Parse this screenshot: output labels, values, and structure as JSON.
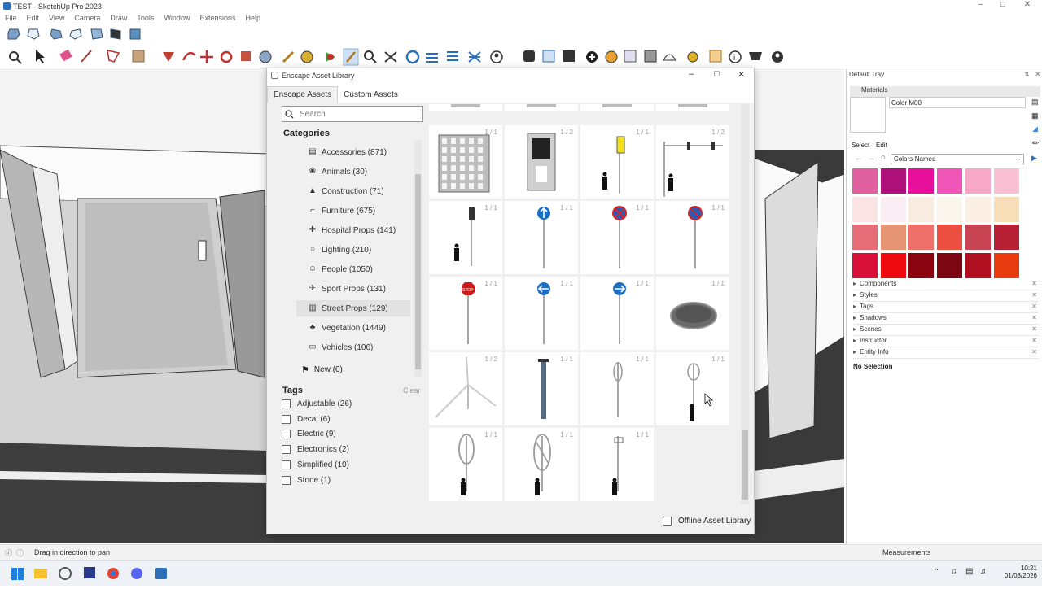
{
  "app": {
    "title": "TEST - SketchUp Pro 2023",
    "menu": [
      "File",
      "Edit",
      "View",
      "Camera",
      "Draw",
      "Tools",
      "Window",
      "Extensions",
      "Help"
    ]
  },
  "dialog": {
    "title": "Enscape Asset Library",
    "tabs": [
      "Enscape Assets",
      "Custom Assets"
    ],
    "search_placeholder": "Search",
    "categories_heading": "Categories",
    "categories": [
      {
        "label": "Accessories (871)",
        "icon": "accessories-icon"
      },
      {
        "label": "Animals (30)",
        "icon": "paw-icon"
      },
      {
        "label": "Construction (71)",
        "icon": "construction-icon"
      },
      {
        "label": "Furniture (675)",
        "icon": "chair-icon"
      },
      {
        "label": "Hospital Props (141)",
        "icon": "hospital-icon"
      },
      {
        "label": "Lighting (210)",
        "icon": "bulb-icon"
      },
      {
        "label": "People (1050)",
        "icon": "people-icon"
      },
      {
        "label": "Sport Props (131)",
        "icon": "sport-icon"
      },
      {
        "label": "Street Props (129)",
        "icon": "street-icon",
        "selected": true
      },
      {
        "label": "Vegetation (1449)",
        "icon": "tree-icon"
      },
      {
        "label": "Vehicles (106)",
        "icon": "car-icon"
      }
    ],
    "new_item": "New (0)",
    "tags_heading": "Tags",
    "clear_label": "Clear",
    "tags": [
      "Adjustable (26)",
      "Decal (6)",
      "Electric (9)",
      "Electronics (2)",
      "Simplified (10)",
      "Stone (1)"
    ],
    "assets": [
      {
        "count": "1 / 1",
        "kind": "building"
      },
      {
        "count": "1 / 2",
        "kind": "kiosk"
      },
      {
        "count": "1 / 1",
        "kind": "traffic-light-ped"
      },
      {
        "count": "1 / 2",
        "kind": "traffic-light-arm"
      },
      {
        "count": "1 / 1",
        "kind": "traffic-light-pole"
      },
      {
        "count": "1 / 1",
        "kind": "sign-blue-up"
      },
      {
        "count": "1 / 1",
        "kind": "sign-no-stop"
      },
      {
        "count": "1 / 1",
        "kind": "sign-no-parking"
      },
      {
        "count": "1 / 1",
        "kind": "sign-stop"
      },
      {
        "count": "1 / 1",
        "kind": "sign-blue-left"
      },
      {
        "count": "1 / 1",
        "kind": "sign-blue-right"
      },
      {
        "count": "1 / 1",
        "kind": "manhole"
      },
      {
        "count": "1 / 2",
        "kind": "wind-turbine"
      },
      {
        "count": "1 / 1",
        "kind": "pole"
      },
      {
        "count": "1 / 1",
        "kind": "vertical-turbine"
      },
      {
        "count": "1 / 1",
        "kind": "vertical-turbine-small"
      },
      {
        "count": "1 / 1",
        "kind": "vertical-turbine-large"
      },
      {
        "count": "1 / 1",
        "kind": "vertical-turbine-twist"
      },
      {
        "count": "1 / 1",
        "kind": "street-lamp-small"
      }
    ],
    "offline_label": "Offline Asset Library"
  },
  "tray": {
    "title": "Default Tray",
    "materials": "Materials",
    "material_name": "Color M00",
    "select": "Select",
    "edit": "Edit",
    "collection": "Colors-Named",
    "swatches": [
      "#e060a0",
      "#b0107a",
      "#e8109a",
      "#f055b8",
      "#f7a8c6",
      "#f9bfd2",
      "#fbe3e3",
      "#f8eef3",
      "#f7ecdf",
      "#faf6ee",
      "#fbeee3",
      "#f6dfb8",
      "#e66c78",
      "#e59574",
      "#ef6f6a",
      "#ec4e40",
      "#c84452",
      "#b52035",
      "#d8103a",
      "#ef0a10",
      "#8a0410",
      "#7c0612",
      "#b01020",
      "#e83c10"
    ],
    "sections": [
      "Components",
      "Styles",
      "Tags",
      "Shadows",
      "Scenes",
      "Instructor",
      "Entity Info"
    ],
    "entity_info": "No Selection"
  },
  "status": {
    "hint": "Drag in direction to pan",
    "measurements": "Measurements"
  },
  "clock": {
    "time": "10:21",
    "date": "01/08/2026"
  }
}
